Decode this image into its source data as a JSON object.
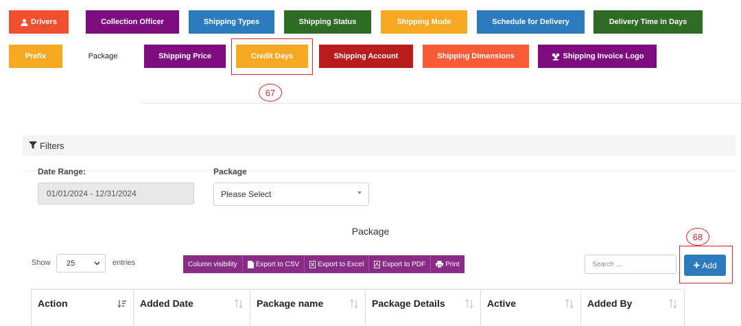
{
  "tabs_row1": [
    {
      "label": "Drivers",
      "icon": "user-icon",
      "color": "#ef4f2e"
    },
    {
      "label": "Collection Officer",
      "color": "#7e0c80"
    },
    {
      "label": "Shipping Types",
      "color": "#2d7bbf"
    },
    {
      "label": "Shipping Status",
      "color": "#2e6b24"
    },
    {
      "label": "Shipping Mode",
      "color": "#f7a823"
    },
    {
      "label": "Schedule for Delivery",
      "color": "#2d7bbf"
    },
    {
      "label": "Delivery Time in Days",
      "color": "#2e6b24"
    }
  ],
  "tabs_row2": [
    {
      "label": "Prefix",
      "color": "#f7a823"
    },
    {
      "label": "Package",
      "color": "#ffffff",
      "active": true
    },
    {
      "label": "Shipping Price",
      "color": "#7e0c80"
    },
    {
      "label": "Credit Days",
      "color": "#f7a823"
    },
    {
      "label": "Shipping Account",
      "color": "#b81c1c"
    },
    {
      "label": "Shipping Dimensions",
      "color": "#fb5b36"
    },
    {
      "label": "Shipping Invoice Logo",
      "icon": "users-icon",
      "color": "#7e0c80"
    }
  ],
  "callouts": {
    "credit_days": "67",
    "add": "68"
  },
  "filters": {
    "title": "Filters",
    "date_range_label": "Date Range:",
    "date_range_value": "01/01/2024 - 12/31/2024",
    "package_label": "Package",
    "package_selected": "Please Select"
  },
  "table": {
    "title": "Package",
    "show_label": "Show",
    "page_length": "25",
    "entries_label": "entries",
    "buttons": [
      "Column visibility",
      "Export to CSV",
      "Export to Excel",
      "Export to PDF",
      "Print"
    ],
    "search_placeholder": "Search ...",
    "add_label": "Add",
    "columns": [
      "Action",
      "Added Date",
      "Package name",
      "Package Details",
      "Active",
      "Added By"
    ]
  }
}
